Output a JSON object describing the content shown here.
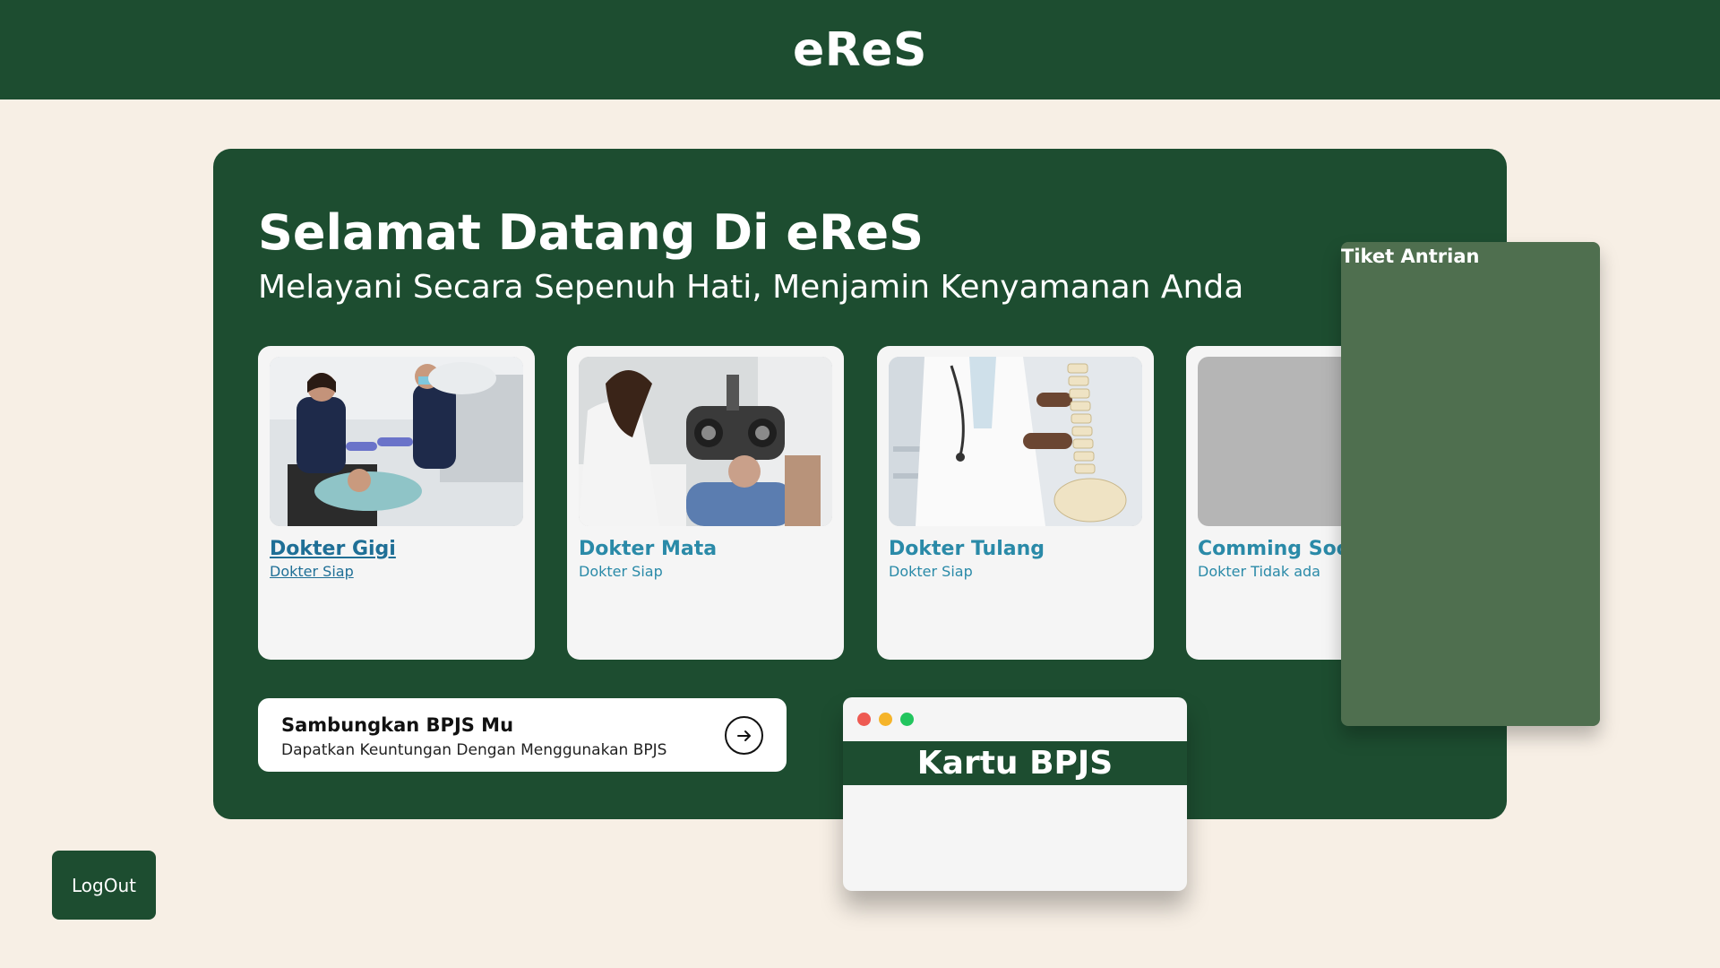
{
  "header": {
    "brand": "eReS",
    "color": "#1d4d30"
  },
  "hero": {
    "title": "Selamat Datang Di eReS",
    "subtitle": "Melayani Secara Sepenuh Hati, Menjamin Kenyamanan Anda"
  },
  "cards": [
    {
      "title": "Dokter Gigi",
      "status": "Dokter Siap",
      "image": "dentist-photo",
      "hovered": true
    },
    {
      "title": "Dokter Mata",
      "status": "Dokter Siap",
      "image": "eye-exam-photo"
    },
    {
      "title": "Dokter Tulang",
      "status": "Dokter Siap",
      "image": "spine-doctor-photo"
    },
    {
      "title": "Comming Soon",
      "status": "Dokter Tidak ada",
      "image": "gray-placeholder"
    }
  ],
  "bpjs_connect": {
    "title": "Sambungkan BPJS Mu",
    "description": "Dapatkan Keuntungan Dengan Menggunakan BPJS",
    "icon": "arrow-right-circle-icon"
  },
  "bpjs_card": {
    "title": "Kartu BPJS",
    "window_dots": [
      "#ee5a52",
      "#f5b42a",
      "#22c55e"
    ]
  },
  "ticket": {
    "label": "Tiket Antrian",
    "color": "#4f6f4f"
  },
  "logout": {
    "label": "LogOut"
  },
  "colors": {
    "background": "#f7efe5",
    "accent_text": "#2a8aa8"
  }
}
